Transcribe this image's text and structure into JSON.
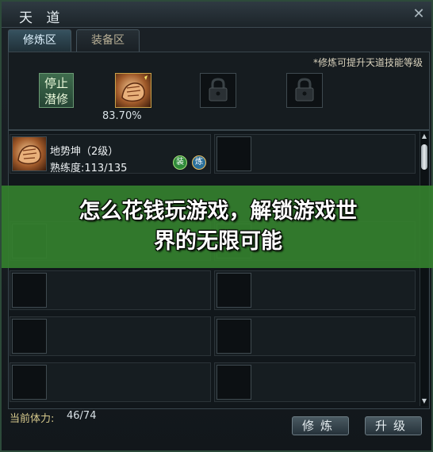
{
  "window": {
    "title": "天 道",
    "close_icon": "close-icon"
  },
  "tabs": [
    {
      "label": "修炼区",
      "active": true
    },
    {
      "label": "装备区",
      "active": false
    }
  ],
  "top": {
    "hint": "*修炼可提升天道技能等级",
    "stop_button_line1": "停止",
    "stop_button_line2": "潜修",
    "active_skill_progress": "83.70%",
    "slot_icons": [
      "fist-skill-icon",
      "lock-icon",
      "lock-icon"
    ]
  },
  "skill_list": [
    {
      "name": "地势坤（2级）",
      "proficiency": "熟练度:113/135",
      "badges": [
        "装",
        "炼"
      ]
    }
  ],
  "banner": {
    "line1": "怎么花钱玩游戏，解锁游戏世",
    "line2": "界的无限可能"
  },
  "footer": {
    "stamina_label": "当前体力:",
    "stamina_value": "46/74",
    "practice_button": "修炼",
    "upgrade_button": "升级"
  },
  "colors": {
    "banner": "#34802e",
    "accent_green": "#3f6c4d",
    "badge_equip": "#2f8a3a",
    "badge_refine": "#2a6f9a"
  }
}
